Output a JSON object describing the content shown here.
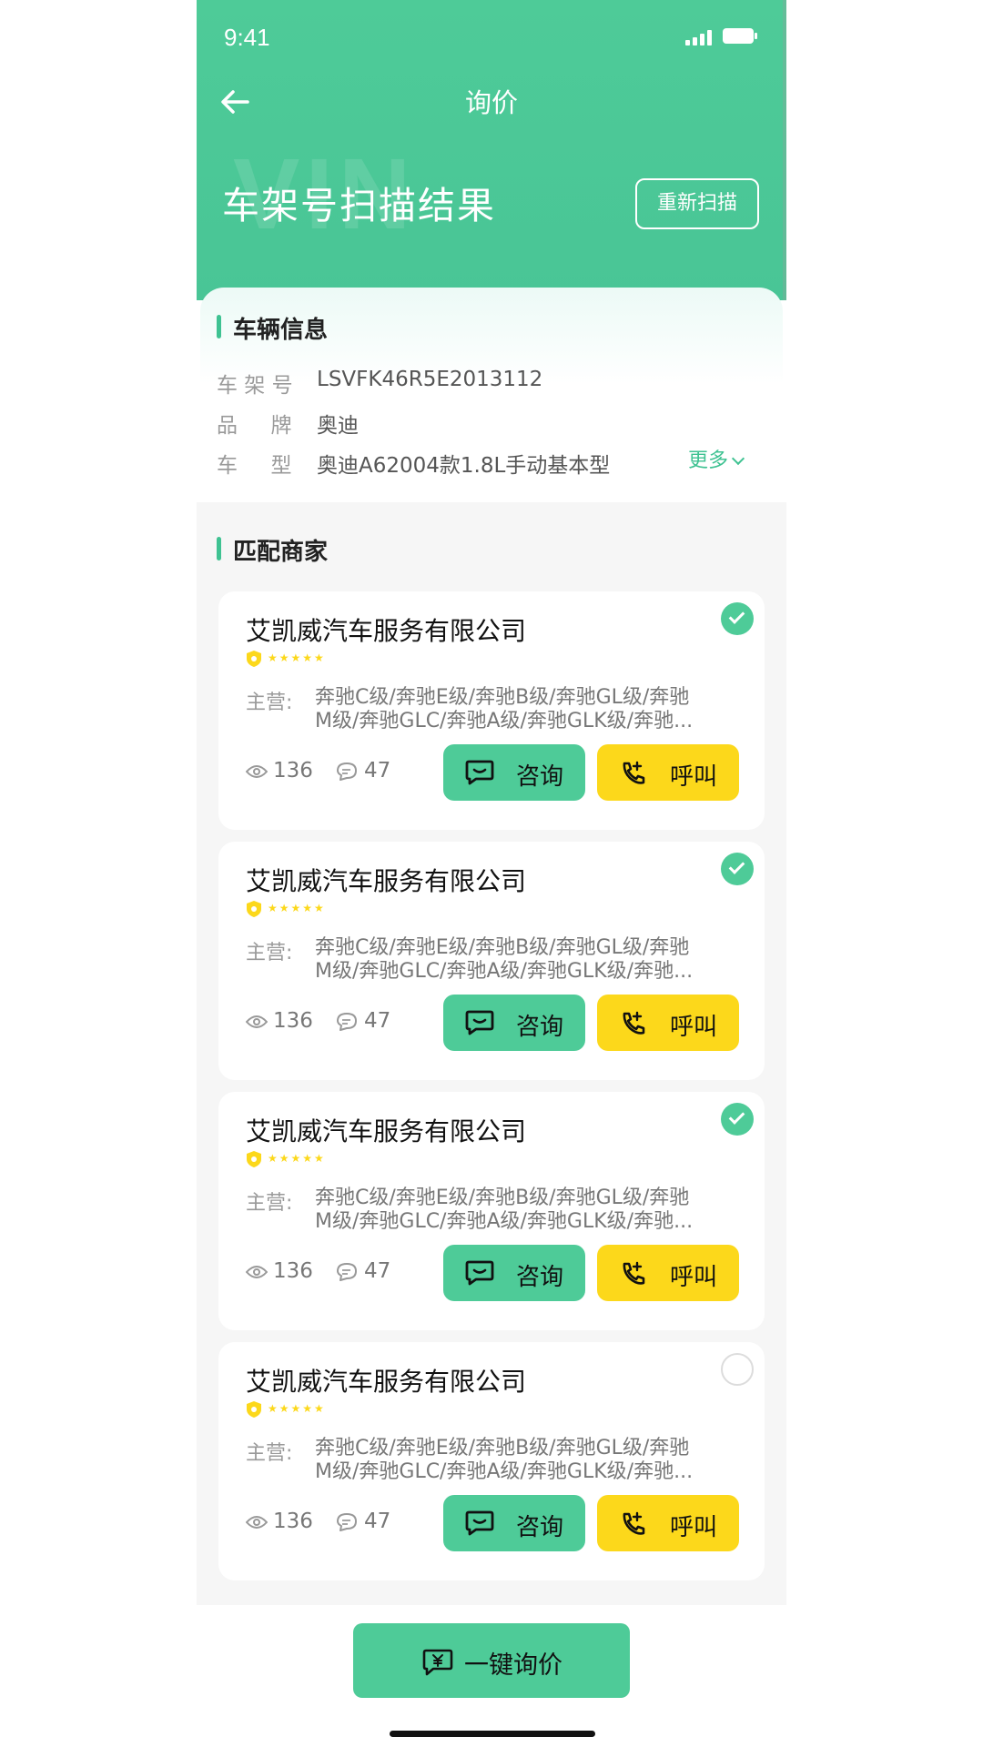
{
  "status_bar": {
    "time": "9:41"
  },
  "nav": {
    "title": "询价"
  },
  "hero": {
    "watermark": "VIN",
    "heading": "车架号扫描结果",
    "rescan_label": "重新扫描"
  },
  "vehicle_info": {
    "section_title": "车辆信息",
    "rows": [
      {
        "label": "车 架 号",
        "value": "LSVFK46R5E2013112"
      },
      {
        "label": "品     牌",
        "value": "奥迪"
      },
      {
        "label": "车     型",
        "value": "奥迪A62004款1.8L手动基本型"
      }
    ],
    "more_label": "更多"
  },
  "merchants": {
    "section_title": "匹配商家",
    "items": [
      {
        "name": "艾凯威汽车服务有限公司",
        "main_label": "主营:",
        "main_line1": "奔驰C级/奔驰E级/奔驰B级/奔驰GL级/奔驰",
        "main_line2": "M级/奔驰GLC/奔驰A级/奔驰GLK级/奔驰...",
        "views": "136",
        "comments": "47",
        "consult_label": "咨询",
        "call_label": "呼叫",
        "selected": true
      },
      {
        "name": "艾凯威汽车服务有限公司",
        "main_label": "主营:",
        "main_line1": "奔驰C级/奔驰E级/奔驰B级/奔驰GL级/奔驰",
        "main_line2": "M级/奔驰GLC/奔驰A级/奔驰GLK级/奔驰...",
        "views": "136",
        "comments": "47",
        "consult_label": "咨询",
        "call_label": "呼叫",
        "selected": true
      },
      {
        "name": "艾凯威汽车服务有限公司",
        "main_label": "主营:",
        "main_line1": "奔驰C级/奔驰E级/奔驰B级/奔驰GL级/奔驰",
        "main_line2": "M级/奔驰GLC/奔驰A级/奔驰GLK级/奔驰...",
        "views": "136",
        "comments": "47",
        "consult_label": "咨询",
        "call_label": "呼叫",
        "selected": true
      },
      {
        "name": "艾凯威汽车服务有限公司",
        "main_label": "主营:",
        "main_line1": "奔驰C级/奔驰E级/奔驰B级/奔驰GL级/奔驰",
        "main_line2": "M级/奔驰GLC/奔驰A级/奔驰GLK级/奔驰...",
        "views": "136",
        "comments": "47",
        "consult_label": "咨询",
        "call_label": "呼叫",
        "selected": false
      }
    ]
  },
  "bottom": {
    "inquiry_label": "一键询价"
  },
  "colors": {
    "primary": "#4ecb98",
    "accent_yellow": "#fcd81b",
    "background": "#f6f6f6"
  },
  "icons": [
    "back-arrow-icon",
    "check-icon",
    "shield-badge-icon",
    "star-icon",
    "eye-icon",
    "comment-icon",
    "chat-icon",
    "phone-icon",
    "yuan-chat-icon"
  ]
}
